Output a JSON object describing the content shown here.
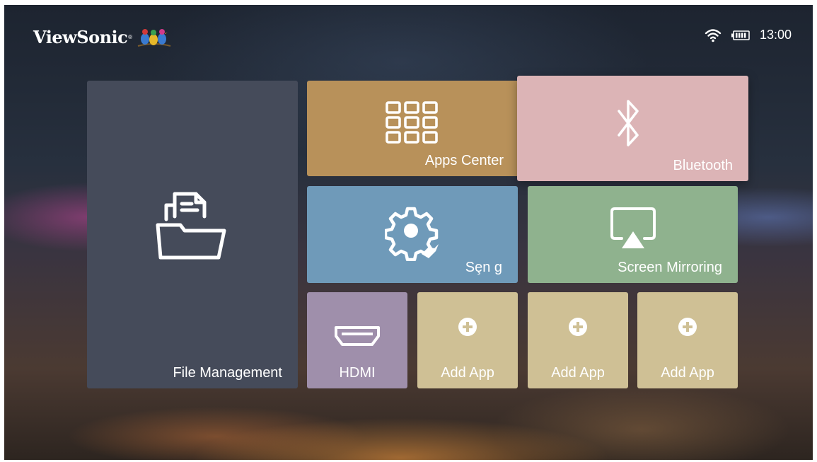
{
  "brand": {
    "name": "ViewSonic",
    "registered_mark": "®"
  },
  "status_bar": {
    "wifi_icon": "wifi-icon",
    "battery_icon": "battery-icon",
    "time": "13:00"
  },
  "tiles": {
    "file_management": {
      "label": "File Management",
      "icon": "folder-files-icon",
      "color": "#454b5a"
    },
    "apps_center": {
      "label": "Apps Center",
      "icon": "grid-icon",
      "color": "#b8915a"
    },
    "bluetooth": {
      "label": "Bluetooth",
      "icon": "bluetooth-icon",
      "color": "#dcb4b6",
      "focused": true
    },
    "setting": {
      "label": "Sȩn g",
      "icon": "gear-icon",
      "color": "#6f9ab9"
    },
    "screen_mirroring": {
      "label": "Screen Mirroring",
      "icon": "screen-cast-icon",
      "color": "#8fb28e"
    },
    "hdmi": {
      "label": "HDMI",
      "icon": "hdmi-icon",
      "color": "#9f8fab"
    },
    "add_apps": [
      {
        "label": "Add App",
        "icon": "plus-circle-icon"
      },
      {
        "label": "Add App",
        "icon": "plus-circle-icon"
      },
      {
        "label": "Add App",
        "icon": "plus-circle-icon"
      }
    ]
  }
}
